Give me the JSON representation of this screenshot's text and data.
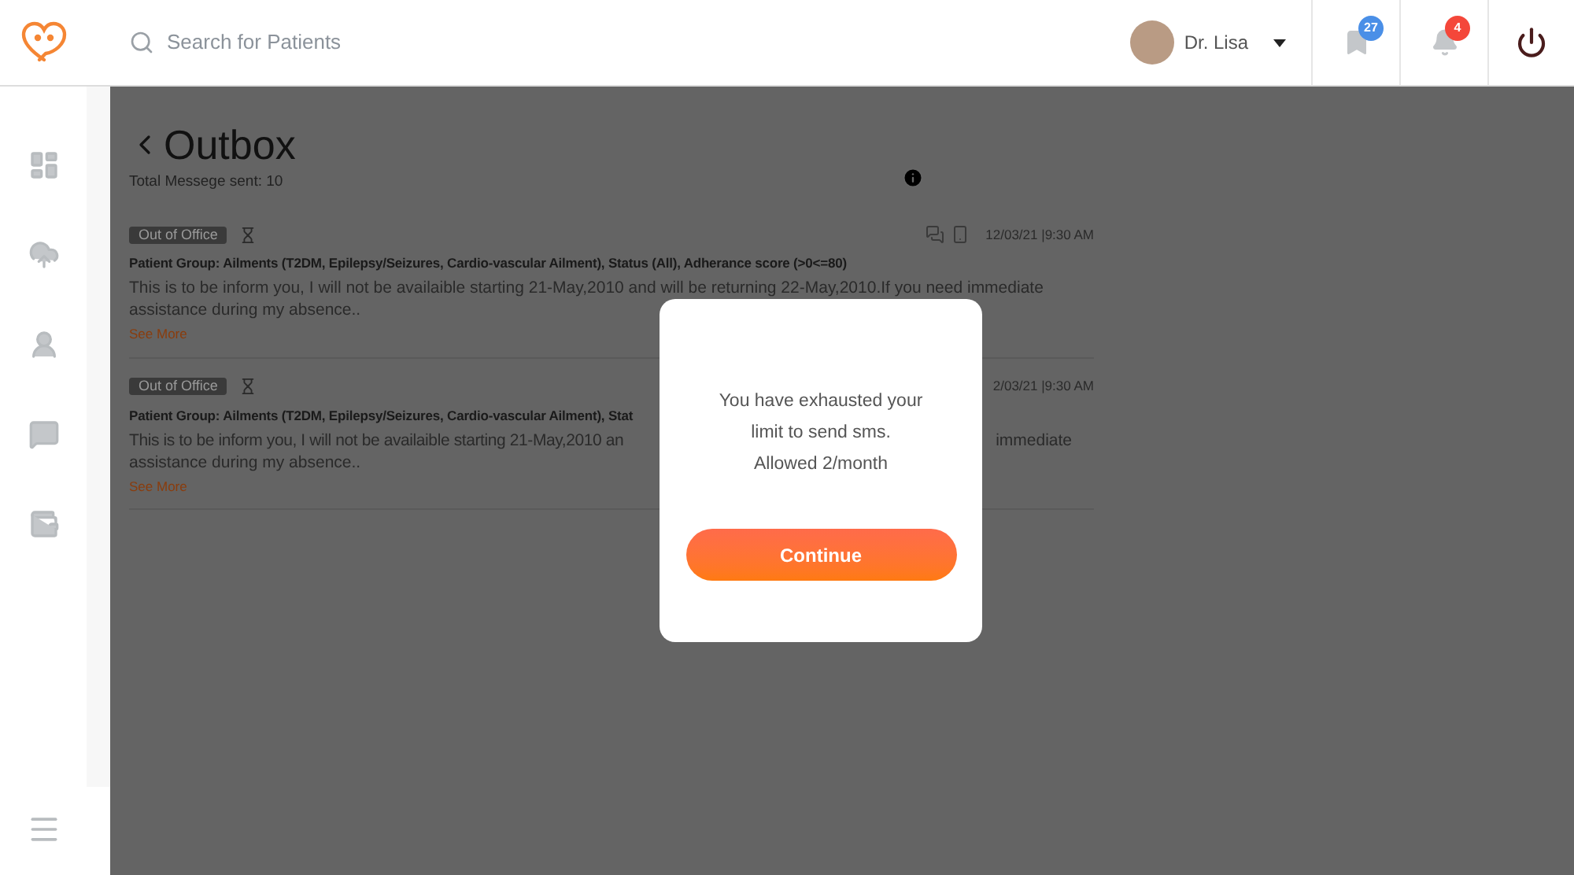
{
  "header": {
    "search": {
      "placeholder": "Search for Patients"
    },
    "user": {
      "name": "Dr. Lisa"
    },
    "bookmarks": {
      "badge": "27"
    },
    "notifications": {
      "badge": "4"
    }
  },
  "page": {
    "title": "Outbox",
    "subtitle": "Total Messege sent: 10"
  },
  "messages": [
    {
      "kind": "full",
      "tag": "Out of Office",
      "date": "12/03/21 |9:30 AM",
      "group": "Patient Group: Ailments (T2DM, Epilepsy/Seizures, Cardio-vascular Ailment), Status (All), Adherance score (>0<=80)",
      "body": "This is to be inform you, I will not be availaible starting 21-May,2010 and will be returning 22-May,2010.If you need immediate assistance during my absence..",
      "link": "See More"
    },
    {
      "kind": "covered",
      "tag": "Out of Office",
      "date": "2/03/21 |9:30 AM",
      "group": "Patient Group: Ailments (T2DM, Epilepsy/Seizures, Cardio-vascular Ailment), Stat",
      "body_left": "This is to be inform you, I will not be availaible starting 21-May,2010 an",
      "body_right": "immediate",
      "body_line2": "assistance during my absence..",
      "link": "See More"
    }
  ],
  "dialog": {
    "lines": [
      "You have exhausted your limit to send sms.",
      "Allowed 2/month"
    ],
    "button": "Continue"
  }
}
